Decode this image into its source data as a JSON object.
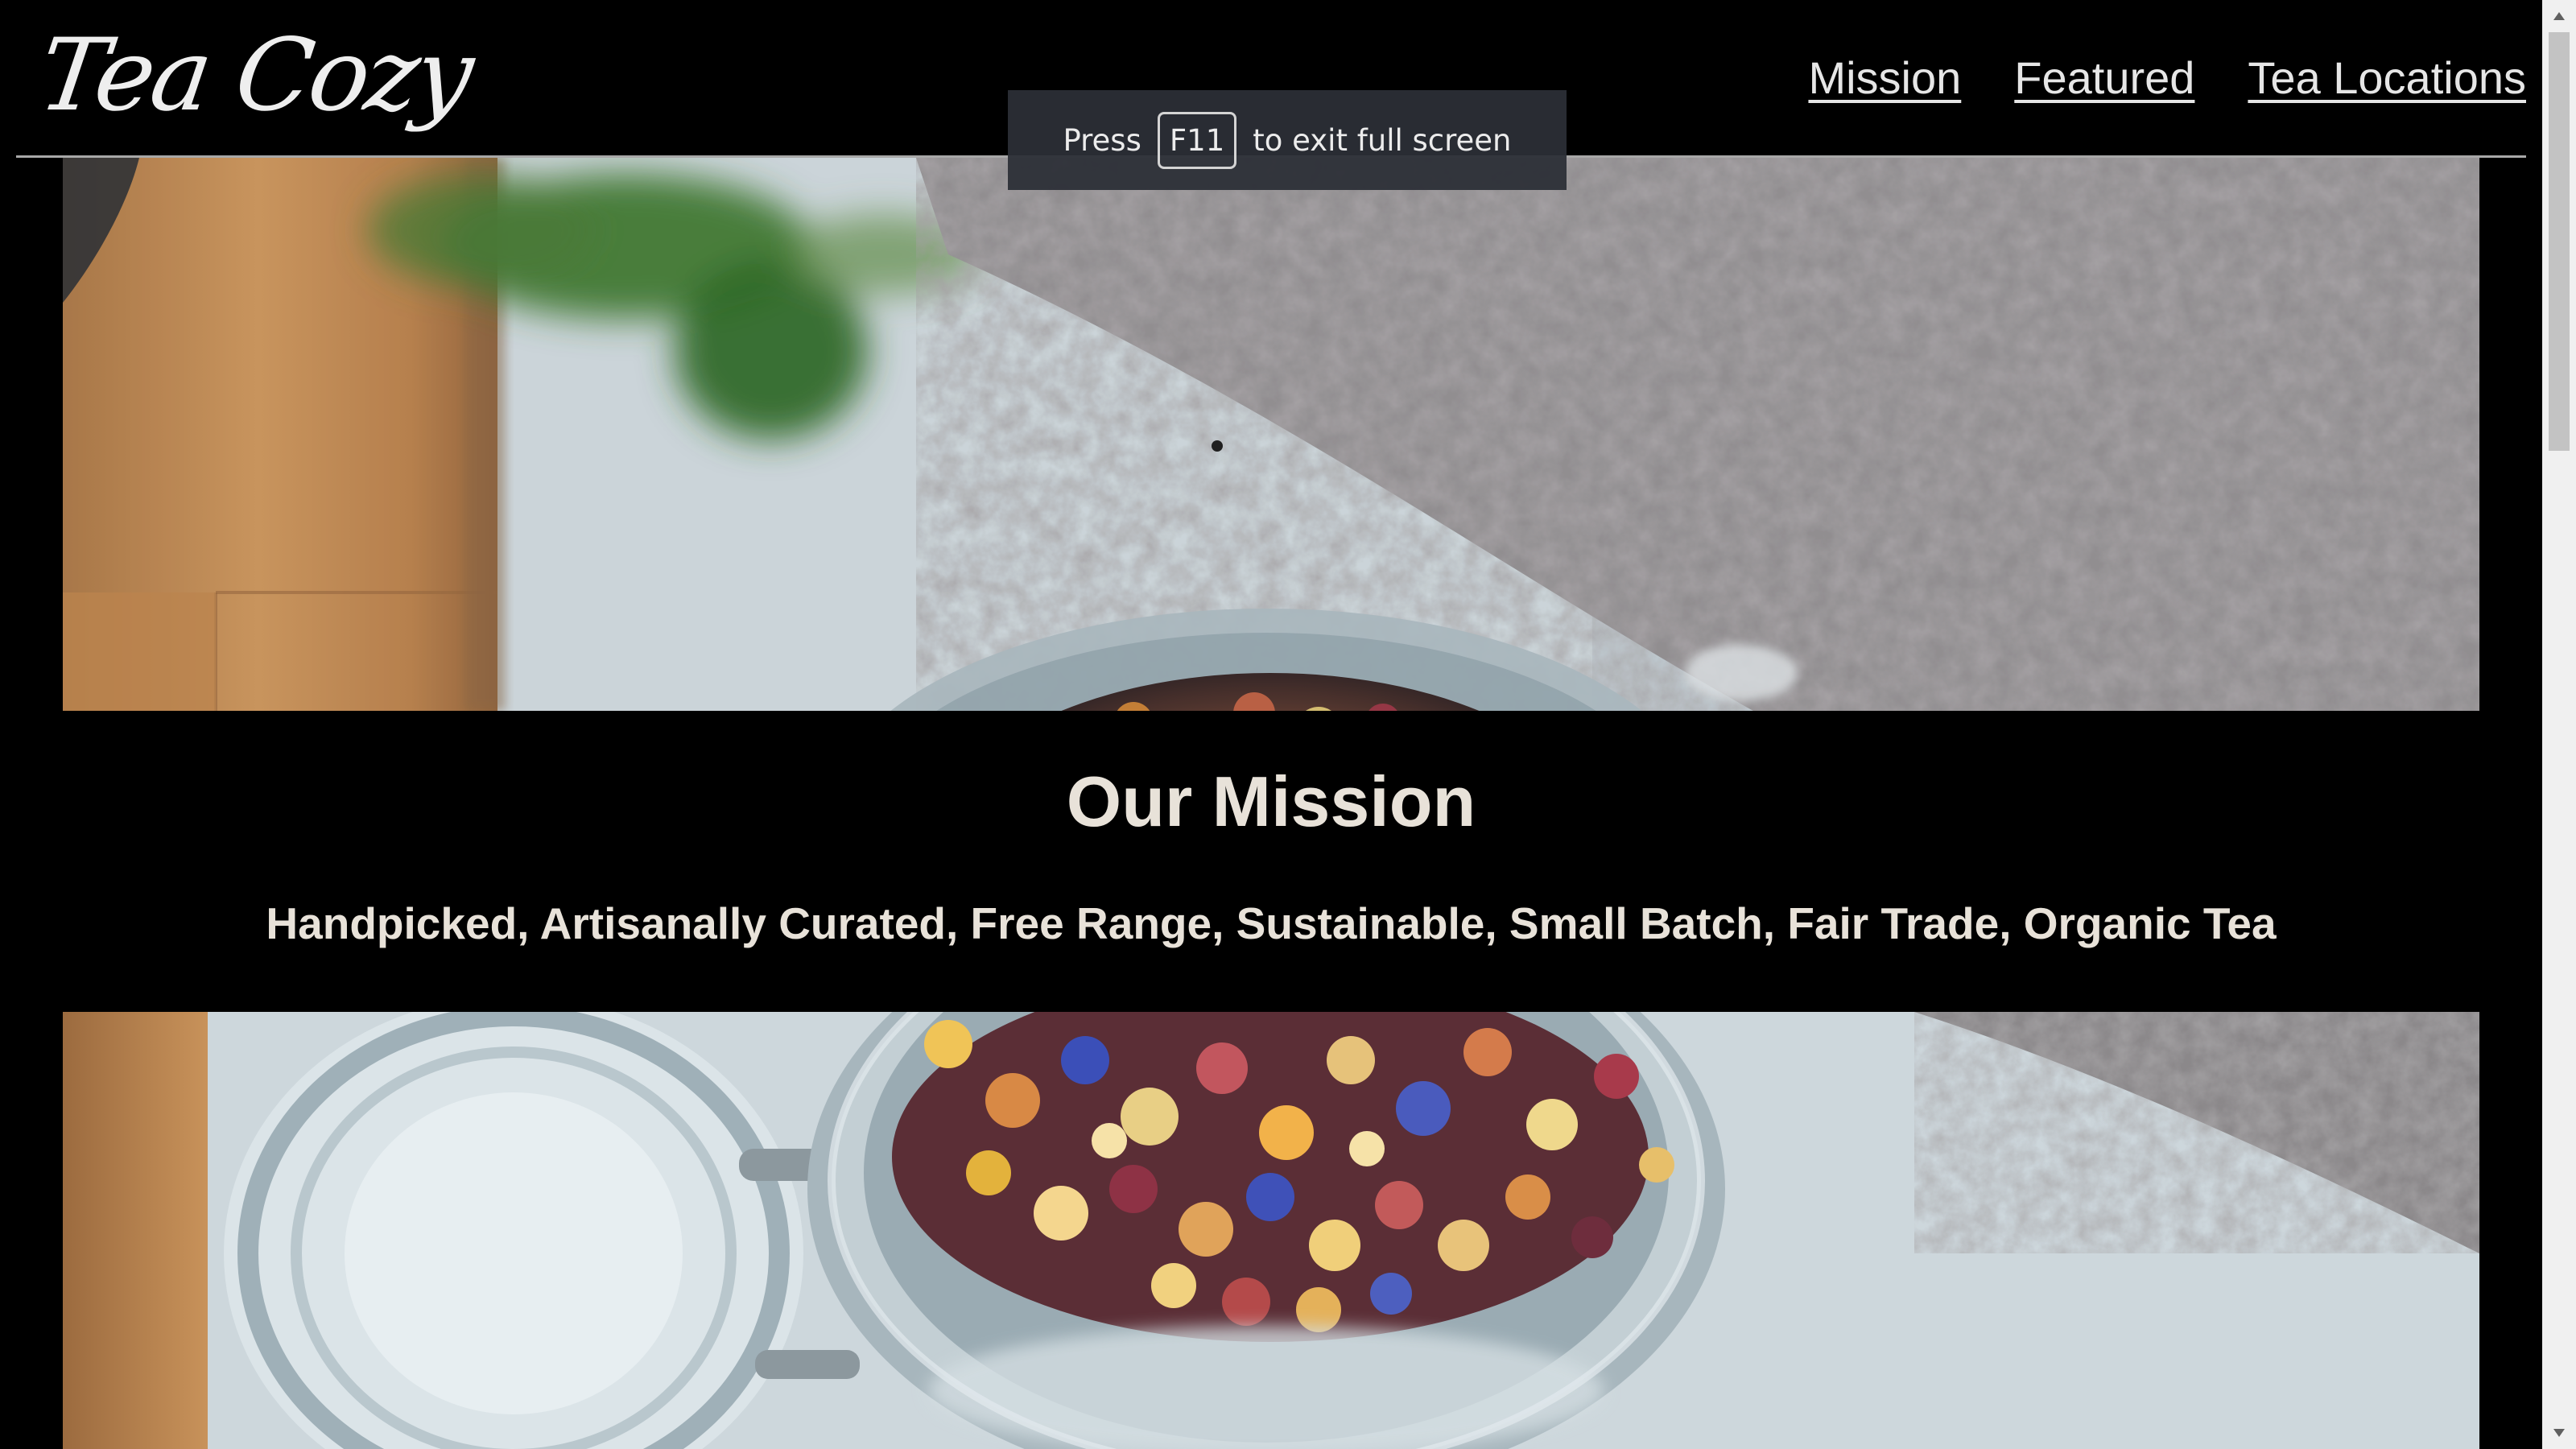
{
  "header": {
    "logo_text": "Tea Cozy",
    "nav": [
      {
        "label": "Mission"
      },
      {
        "label": "Featured"
      },
      {
        "label": "Tea Locations"
      }
    ]
  },
  "fullscreen_notice": {
    "prefix": "Press",
    "key": "F11",
    "suffix": "to exit full screen"
  },
  "mission": {
    "title": "Our Mission",
    "subtitle": "Handpicked, Artisanally Curated, Free Range, Sustainable, Small Batch, Fair Trade, Organic Tea"
  },
  "images": {
    "top": {
      "content": "loose-leaf-tea-jar-photo"
    },
    "bottom": {
      "content": "open-tea-jar-photo"
    }
  },
  "colors": {
    "background": "#000000",
    "text": "#e8e2d9",
    "header_rule": "#a8a8a8"
  },
  "icons": {
    "scroll_up": "triangle-up-icon",
    "scroll_down": "triangle-down-icon"
  }
}
